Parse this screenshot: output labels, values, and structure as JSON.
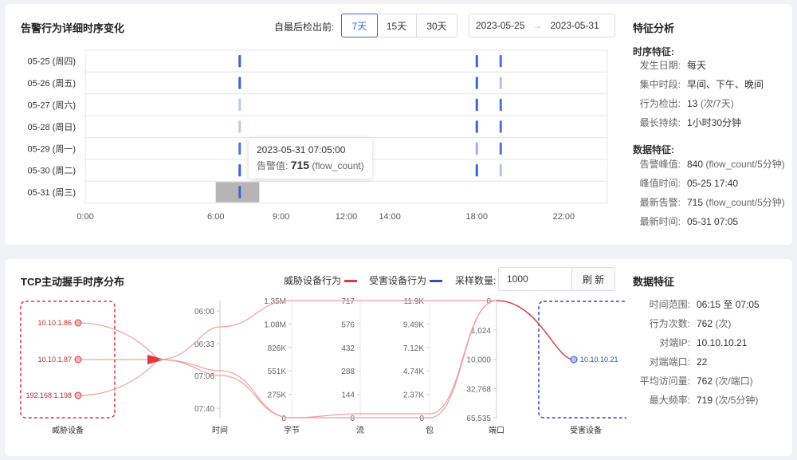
{
  "timeline": {
    "title": "告警行为详细时序变化",
    "range_label": "自最后检出前:",
    "ranges": [
      "7天",
      "15天",
      "30天"
    ],
    "active_range": "7天",
    "date_start": "2023-05-25",
    "date_arrow": "→",
    "date_end": "2023-05-31",
    "rows": [
      "05-25 (周四)",
      "05-26 (周五)",
      "05-27 (周六)",
      "05-28 (周日)",
      "05-29 (周一)",
      "05-30 (周二)",
      "05-31 (周三)"
    ],
    "x_ticks": [
      "0:00",
      "6:00",
      "9:00",
      "12:00",
      "14:00",
      "18:00",
      "22:00"
    ],
    "tooltip": {
      "time": "2023-05-31 07:05:00",
      "label": "告警值:",
      "value": "715",
      "unit": "(flow_count)"
    }
  },
  "feature_analysis": {
    "title": "特征分析",
    "timing_title": "时序特征:",
    "timing": [
      {
        "k": "发生日期:",
        "v": "每天",
        "u": ""
      },
      {
        "k": "集中时段:",
        "v": "早间、下午、晚间",
        "u": ""
      },
      {
        "k": "行为检出:",
        "v": "13",
        "u": "(次/7天)"
      },
      {
        "k": "最长持续:",
        "v": "1小时30分钟",
        "u": ""
      }
    ],
    "data_title": "数据特征:",
    "data": [
      {
        "k": "告警峰值:",
        "v": "840",
        "u": "(flow_count/5分钟)"
      },
      {
        "k": "峰值时间:",
        "v": "05-25 17:40",
        "u": ""
      },
      {
        "k": "最新告警:",
        "v": "715",
        "u": "(flow_count/5分钟)"
      },
      {
        "k": "最新时间:",
        "v": "05-31 07:05",
        "u": ""
      }
    ]
  },
  "tcp": {
    "title": "TCP主动握手时序分布",
    "legend_threat": "威胁设备行为",
    "legend_victim": "受害设备行为",
    "sample_label": "采样数量:",
    "sample_value": "1000",
    "refresh_label": "刷 新",
    "threat_ips": [
      "10.10.1.86",
      "10.10.1.87",
      "192.168.1.198"
    ],
    "victim_ip": "10.10.10.21",
    "threat_caption": "威胁设备",
    "victim_caption": "受害设备",
    "axes": [
      {
        "name": "时间",
        "ticks": [
          "06:00",
          "06:33",
          "07:06",
          "07:40"
        ]
      },
      {
        "name": "字节",
        "ticks": [
          "1.35M",
          "1.08M",
          "826K",
          "551K",
          "275K",
          "0"
        ]
      },
      {
        "name": "流",
        "ticks": [
          "717",
          "576",
          "432",
          "288",
          "144",
          "0"
        ]
      },
      {
        "name": "包",
        "ticks": [
          "11.9K",
          "9.49K",
          "7.12K",
          "4.74K",
          "2.37K",
          "0"
        ]
      },
      {
        "name": "端口",
        "ticks": [
          "0",
          "1,024",
          "10,000",
          "32,768",
          "65,535"
        ]
      }
    ]
  },
  "data_features": {
    "title": "数据特征",
    "items": [
      {
        "k": "时间范围:",
        "v": "06:15 至 07:05",
        "u": ""
      },
      {
        "k": "行为次数:",
        "v": "762",
        "u": "(次)"
      },
      {
        "k": "对端IP:",
        "v": "10.10.10.21",
        "u": ""
      },
      {
        "k": "对端端口:",
        "v": "22",
        "u": ""
      },
      {
        "k": "平均访问量:",
        "v": "762",
        "u": "(次/端口)"
      },
      {
        "k": "最大频率:",
        "v": "719",
        "u": "(次/5分钟)"
      }
    ]
  },
  "colors": {
    "accent": "#3b64d8",
    "threat": "#e0393e",
    "victim": "#2f4fc4",
    "grid": "#e4e7ed"
  }
}
